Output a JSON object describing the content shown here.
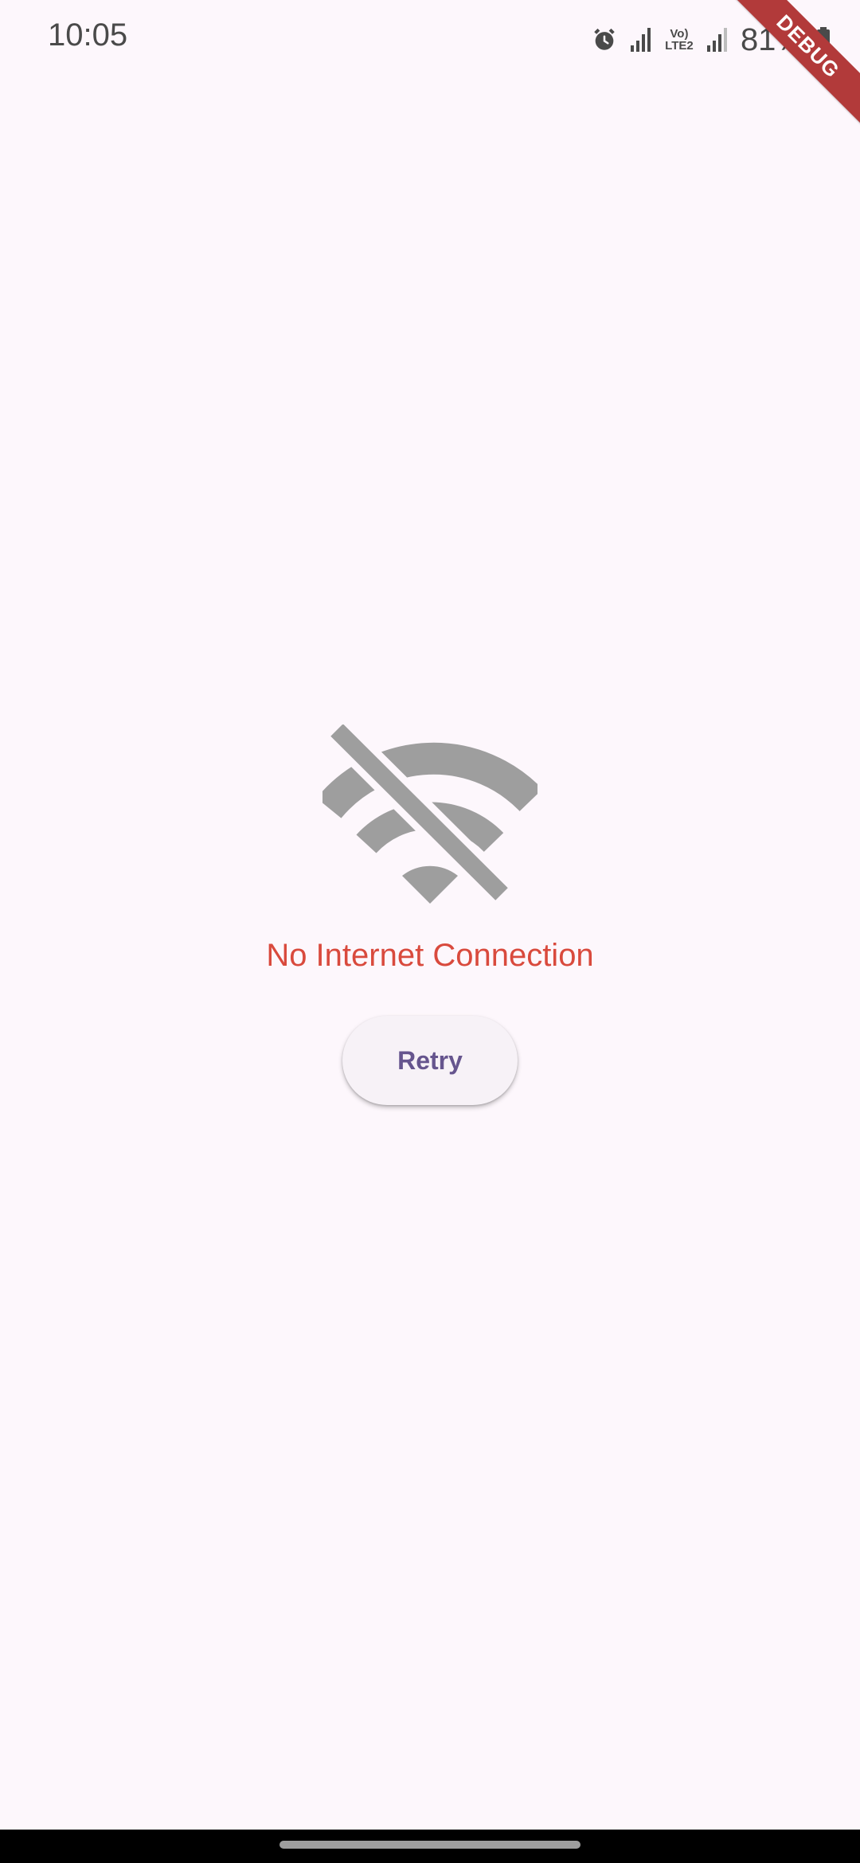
{
  "status_bar": {
    "time": "10:05",
    "volte_label": "Vo) LTE2",
    "battery": "81%",
    "icons": [
      "alarm-icon",
      "signal-icon",
      "signal-icon",
      "battery-icon"
    ]
  },
  "debug_banner": {
    "label": "DEBUG"
  },
  "main": {
    "icon": "wifi-off-icon",
    "icon_color": "#9E9E9E",
    "message": "No Internet Connection",
    "message_color": "#D94A3D",
    "retry_label": "Retry",
    "retry_color": "#66558E"
  },
  "colors": {
    "background": "#FDF7FC",
    "debug": "#B23A3A"
  }
}
